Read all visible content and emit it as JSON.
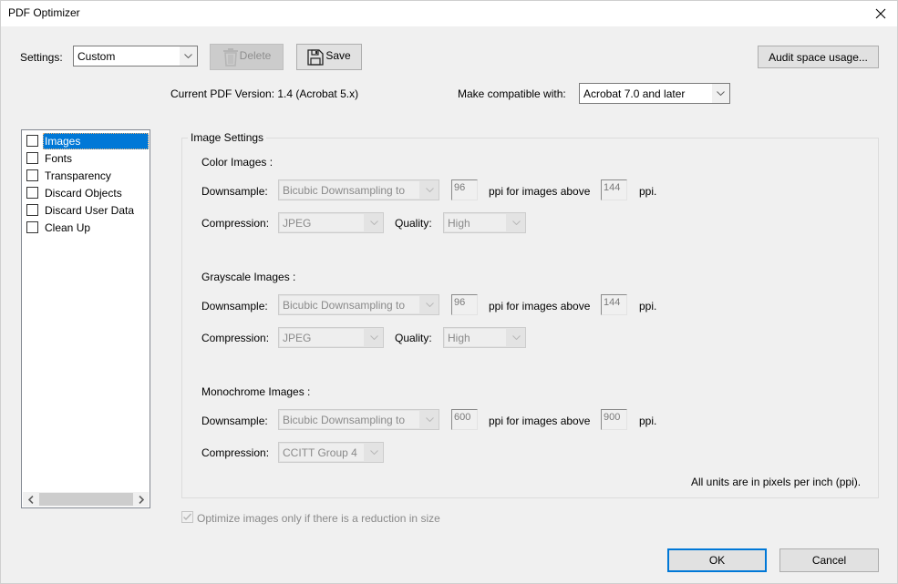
{
  "window": {
    "title": "PDF Optimizer",
    "close_icon": "close-x-icon"
  },
  "toolbar": {
    "settings_label": "Settings:",
    "settings_value": "Custom",
    "delete_label": "Delete",
    "delete_icon": "trash-icon",
    "save_label": "Save",
    "save_icon": "floppy-disk-icon",
    "audit_label": "Audit space usage..."
  },
  "version": {
    "current_label": "Current PDF Version: 1.4 (Acrobat 5.x)",
    "compat_label": "Make compatible with:",
    "compat_value": "Acrobat 7.0 and later"
  },
  "sidebar": {
    "items": [
      {
        "label": "Images",
        "checked": false,
        "selected": true
      },
      {
        "label": "Fonts",
        "checked": false,
        "selected": false
      },
      {
        "label": "Transparency",
        "checked": false,
        "selected": false
      },
      {
        "label": "Discard Objects",
        "checked": false,
        "selected": false
      },
      {
        "label": "Discard User Data",
        "checked": false,
        "selected": false
      },
      {
        "label": "Clean Up",
        "checked": false,
        "selected": false
      }
    ],
    "scroll_left": "‹",
    "scroll_right": "›"
  },
  "image_settings": {
    "title": "Image Settings",
    "downsample_label": "Downsample:",
    "compression_label": "Compression:",
    "quality_label": "Quality:",
    "ppi_above_label": "ppi for images above",
    "ppi_label": "ppi.",
    "color": {
      "heading": "Color Images :",
      "downsample": "Bicubic Downsampling to",
      "ppi": "96",
      "above_ppi": "144",
      "compression": "JPEG",
      "quality": "High"
    },
    "grayscale": {
      "heading": "Grayscale Images :",
      "downsample": "Bicubic Downsampling to",
      "ppi": "96",
      "above_ppi": "144",
      "compression": "JPEG",
      "quality": "High"
    },
    "monochrome": {
      "heading": "Monochrome Images :",
      "downsample": "Bicubic Downsampling to",
      "ppi": "600",
      "above_ppi": "900",
      "compression": "CCITT Group 4"
    },
    "units_note": "All units are in pixels per inch (ppi)."
  },
  "optimize_only": {
    "label": "Optimize images only if there is a reduction in size",
    "checked": true,
    "enabled": false
  },
  "footer": {
    "ok_label": "OK",
    "cancel_label": "Cancel"
  },
  "colors": {
    "accent": "#0078d7",
    "window_bg": "#f0f0f0",
    "disabled_text": "#8a8a8a"
  }
}
